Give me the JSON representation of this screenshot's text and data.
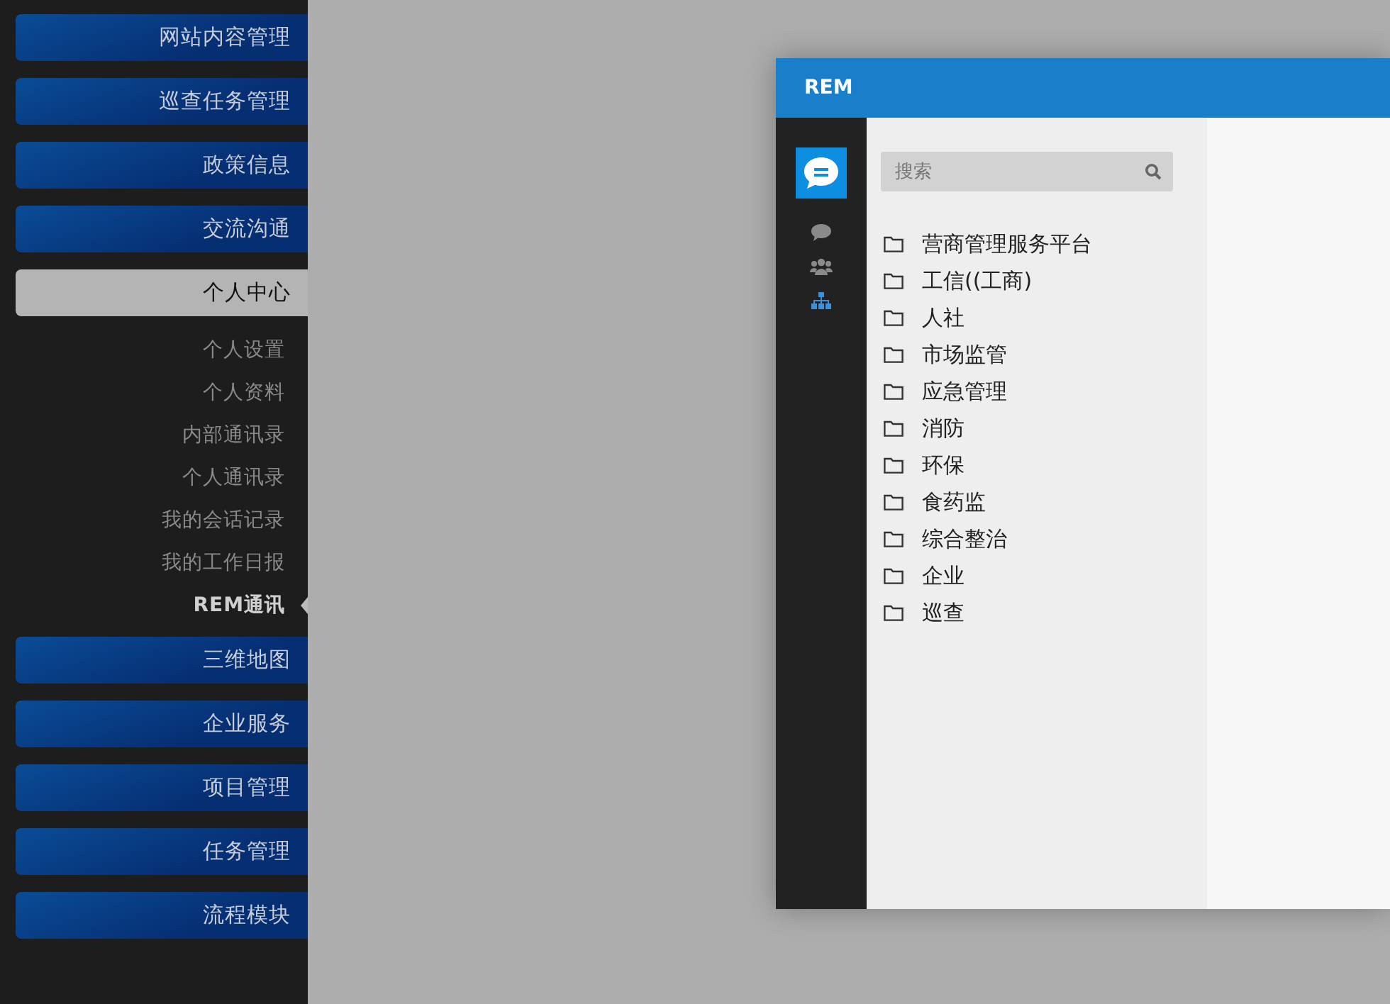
{
  "sidebar": {
    "items": [
      {
        "label": "网站内容管理",
        "selected": false
      },
      {
        "label": "巡查任务管理",
        "selected": false
      },
      {
        "label": "政策信息",
        "selected": false
      },
      {
        "label": "交流沟通",
        "selected": false
      },
      {
        "label": "个人中心",
        "selected": true,
        "children": [
          {
            "label": "个人设置",
            "selected": false
          },
          {
            "label": "个人资料",
            "selected": false
          },
          {
            "label": "内部通讯录",
            "selected": false
          },
          {
            "label": "个人通讯录",
            "selected": false
          },
          {
            "label": "我的会话记录",
            "selected": false
          },
          {
            "label": "我的工作日报",
            "selected": false
          },
          {
            "label": "REM通讯",
            "selected": true
          }
        ]
      },
      {
        "label": "三维地图",
        "selected": false
      },
      {
        "label": "企业服务",
        "selected": false
      },
      {
        "label": "项目管理",
        "selected": false
      },
      {
        "label": "任务管理",
        "selected": false
      },
      {
        "label": "流程模块",
        "selected": false
      }
    ]
  },
  "dialog": {
    "title": "REM",
    "nav_tabs": [
      {
        "kind": "chat",
        "selected": false
      },
      {
        "kind": "group",
        "selected": false
      },
      {
        "kind": "org",
        "selected": true
      }
    ],
    "search": {
      "placeholder": "搜索"
    },
    "tree": [
      {
        "label": "营商管理服务平台"
      },
      {
        "label": "工信((工商)"
      },
      {
        "label": "人社"
      },
      {
        "label": "市场监管"
      },
      {
        "label": "应急管理"
      },
      {
        "label": "消防"
      },
      {
        "label": "环保"
      },
      {
        "label": "食药监"
      },
      {
        "label": "综合整治"
      },
      {
        "label": "企业"
      },
      {
        "label": "巡查"
      }
    ]
  }
}
